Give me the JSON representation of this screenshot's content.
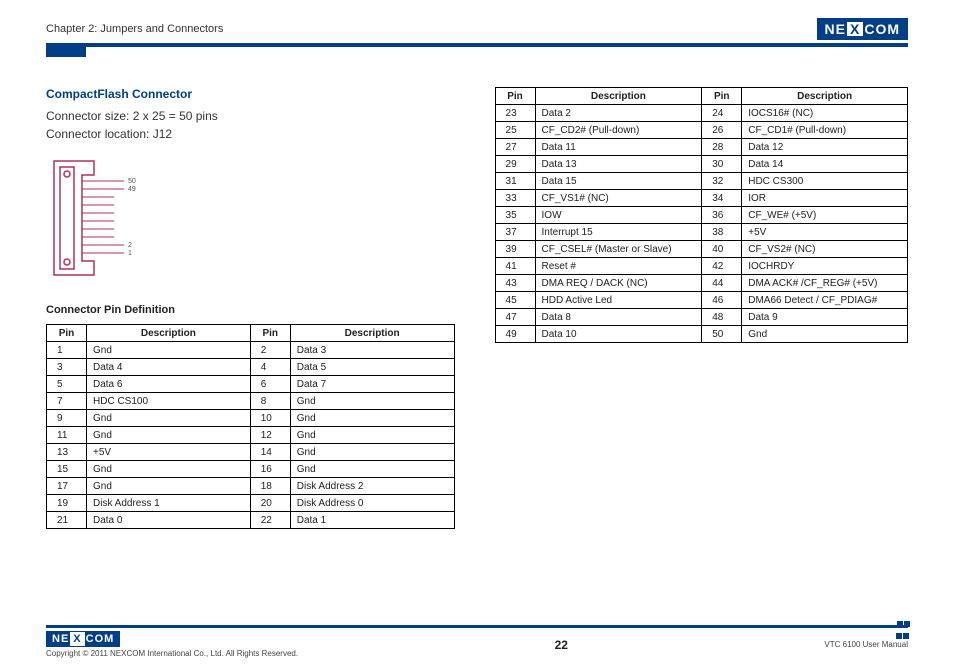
{
  "header": {
    "chapter": "Chapter 2: Jumpers and Connectors",
    "logo": {
      "pre": "NE",
      "mid": "X",
      "post": "COM"
    }
  },
  "section": {
    "title": "CompactFlash Connector",
    "line1": "Connector size: 2 x 25 = 50 pins",
    "line2": "Connector location: J12",
    "subheading": "Connector Pin Definition"
  },
  "table_headers": {
    "pin": "Pin",
    "desc": "Description"
  },
  "diagram_labels": {
    "top": "50",
    "upper": "49",
    "lower": "2",
    "bottom": "1"
  },
  "pins_left": [
    {
      "p1": "1",
      "d1": "Gnd",
      "p2": "2",
      "d2": "Data 3"
    },
    {
      "p1": "3",
      "d1": "Data 4",
      "p2": "4",
      "d2": "Data 5"
    },
    {
      "p1": "5",
      "d1": "Data 6",
      "p2": "6",
      "d2": "Data 7"
    },
    {
      "p1": "7",
      "d1": "HDC CS100",
      "p2": "8",
      "d2": "Gnd"
    },
    {
      "p1": "9",
      "d1": "Gnd",
      "p2": "10",
      "d2": "Gnd"
    },
    {
      "p1": "11",
      "d1": "Gnd",
      "p2": "12",
      "d2": "Gnd"
    },
    {
      "p1": "13",
      "d1": "+5V",
      "p2": "14",
      "d2": "Gnd"
    },
    {
      "p1": "15",
      "d1": "Gnd",
      "p2": "16",
      "d2": "Gnd"
    },
    {
      "p1": "17",
      "d1": "Gnd",
      "p2": "18",
      "d2": "Disk Address 2"
    },
    {
      "p1": "19",
      "d1": "Disk Address 1",
      "p2": "20",
      "d2": "Disk Address 0"
    },
    {
      "p1": "21",
      "d1": "Data 0",
      "p2": "22",
      "d2": "Data 1"
    }
  ],
  "pins_right": [
    {
      "p1": "23",
      "d1": "Data 2",
      "p2": "24",
      "d2": "IOCS16# (NC)"
    },
    {
      "p1": "25",
      "d1": "CF_CD2# (Pull-down)",
      "p2": "26",
      "d2": "CF_CD1# (Pull-down)"
    },
    {
      "p1": "27",
      "d1": "Data 11",
      "p2": "28",
      "d2": "Data 12"
    },
    {
      "p1": "29",
      "d1": "Data 13",
      "p2": "30",
      "d2": "Data 14"
    },
    {
      "p1": "31",
      "d1": "Data 15",
      "p2": "32",
      "d2": "HDC CS300"
    },
    {
      "p1": "33",
      "d1": "CF_VS1# (NC)",
      "p2": "34",
      "d2": "IOR"
    },
    {
      "p1": "35",
      "d1": "IOW",
      "p2": "36",
      "d2": "CF_WE# (+5V)"
    },
    {
      "p1": "37",
      "d1": "Interrupt 15",
      "p2": "38",
      "d2": "+5V"
    },
    {
      "p1": "39",
      "d1": "CF_CSEL# (Master or Slave)",
      "p2": "40",
      "d2": "CF_VS2# (NC)"
    },
    {
      "p1": "41",
      "d1": "Reset #",
      "p2": "42",
      "d2": "IOCHRDY"
    },
    {
      "p1": "43",
      "d1": "DMA REQ / DACK (NC)",
      "p2": "44",
      "d2": "DMA ACK# /CF_REG# (+5V)"
    },
    {
      "p1": "45",
      "d1": "HDD Active Led",
      "p2": "46",
      "d2": "DMA66 Detect / CF_PDIAG#"
    },
    {
      "p1": "47",
      "d1": "Data 8",
      "p2": "48",
      "d2": "Data 9"
    },
    {
      "p1": "49",
      "d1": "Data 10",
      "p2": "50",
      "d2": "Gnd"
    }
  ],
  "footer": {
    "copyright": "Copyright © 2011 NEXCOM International Co., Ltd. All Rights Reserved.",
    "page": "22",
    "manual": "VTC 6100 User Manual"
  }
}
